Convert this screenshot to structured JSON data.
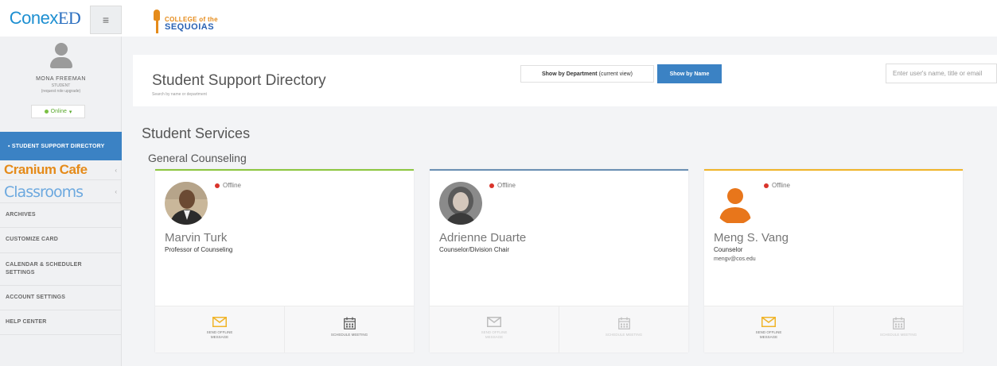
{
  "topbar": {
    "brand_conex": "Conex",
    "brand_ed": "ED",
    "menu_icon": "≡",
    "college_line1": "COLLEGE of the",
    "college_line2": "SEQUOIAS"
  },
  "sidebar": {
    "user_name": "MONA FREEMAN",
    "user_role": "STUDENT",
    "role_upgrade": "(request role upgrade)",
    "status_label": "Online",
    "status_caret": "▾",
    "active_item": "▪  STUDENT SUPPORT DIRECTORY",
    "cranium_label": "Cranium Cafe",
    "classrooms_label": "Classrooms",
    "chevron": "‹",
    "items": [
      {
        "label": "ARCHIVES"
      },
      {
        "label": "CUSTOMIZE CARD"
      },
      {
        "label": "CALENDAR & SCHEDULER SETTINGS"
      },
      {
        "label": "ACCOUNT SETTINGS"
      },
      {
        "label": "HELP CENTER"
      }
    ]
  },
  "header": {
    "title": "Student Support Directory",
    "subtitle": "Search by name or department",
    "show_dept_label": "Show by Department",
    "current_view": "(current view)",
    "show_name_label": "Show by Name",
    "search_placeholder": "Enter user's name, title or email"
  },
  "main": {
    "section_title": "Student Services",
    "department_title": "General Counseling",
    "cards": [
      {
        "status": "Offline",
        "name": "Marvin Turk",
        "title": "Professor of Counseling",
        "email": "",
        "accent_color": "#8cc63f",
        "message_label": "SEND OFFLINE MESSAGE",
        "schedule_label": "SCHEDULE MEETING"
      },
      {
        "status": "Offline",
        "name": "Adrienne Duarte",
        "title": "Counselor/Division Chair",
        "email": "",
        "accent_color": "#6a8fb3",
        "message_label": "SEND OFFLINE MESSAGE",
        "schedule_label": "SCHEDULE MEETING"
      },
      {
        "status": "Offline",
        "name": "Meng S. Vang",
        "title": "Counselor",
        "email": "mengv@cos.edu",
        "accent_color": "#f0b429",
        "message_label": "SEND OFFLINE MESSAGE",
        "schedule_label": "SCHEDULE MEETING"
      }
    ]
  },
  "colors": {
    "primary": "#3b82c4",
    "offline": "#d9342b",
    "online": "#7bc043",
    "accent_orange": "#e58b1a"
  }
}
